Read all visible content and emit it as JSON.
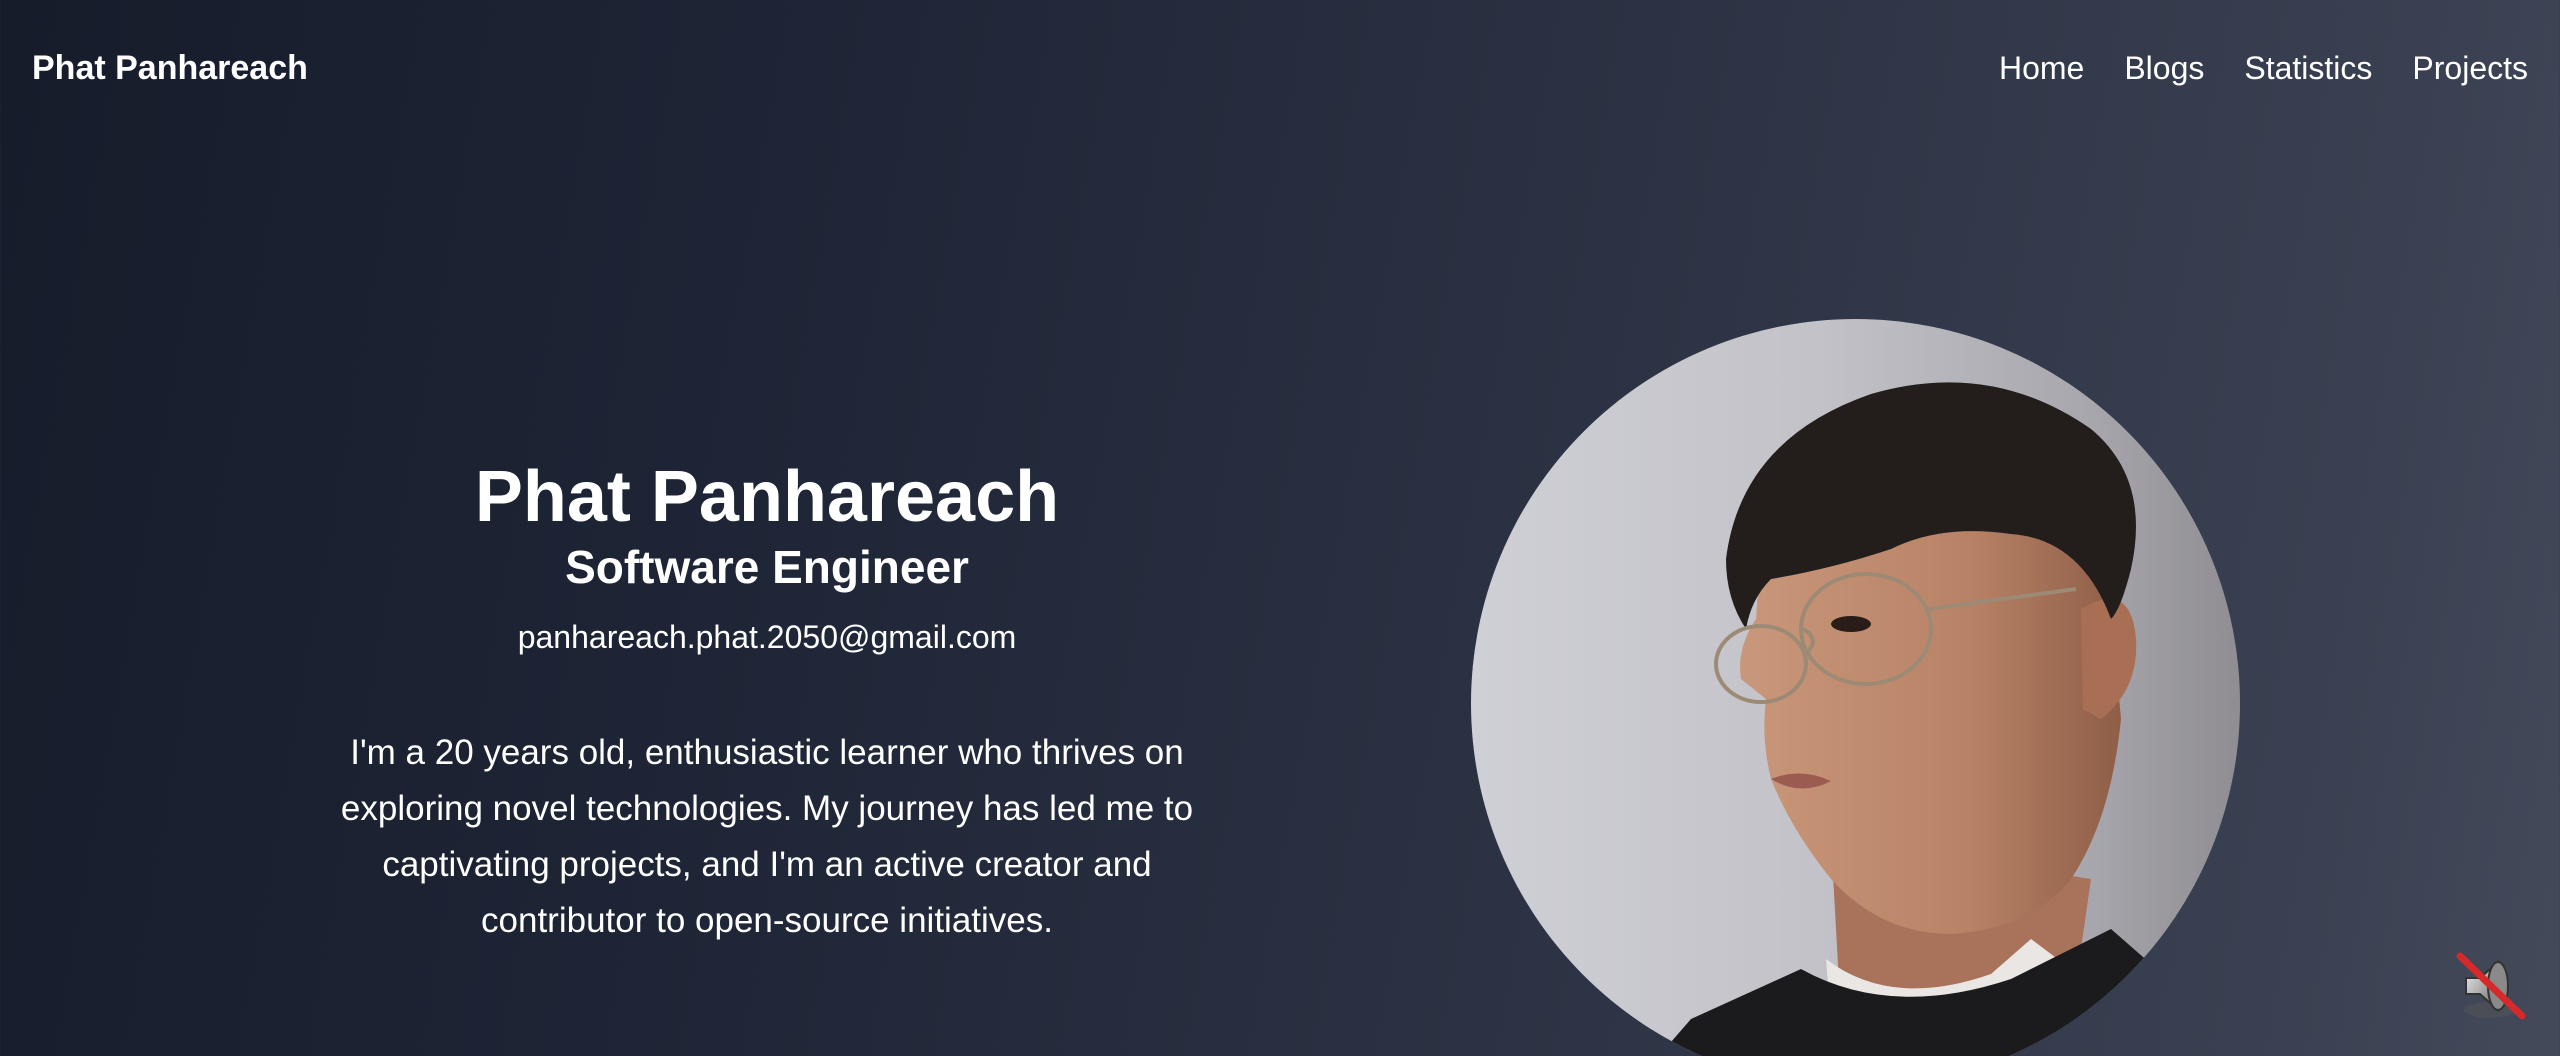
{
  "header": {
    "brand": "Phat Panhareach",
    "nav": [
      {
        "label": "Home"
      },
      {
        "label": "Blogs"
      },
      {
        "label": "Statistics"
      },
      {
        "label": "Projects"
      }
    ]
  },
  "hero": {
    "name": "Phat Panhareach",
    "title": "Software Engineer",
    "email": "panhareach.phat.2050@gmail.com",
    "bio": "I'm a 20 years old, enthusiastic learner who thrives on exploring novel technologies. My journey has led me to captivating projects, and I'm an active creator and contributor to open-source initiatives."
  },
  "icons": {
    "sound_toggle": "speaker-muted-icon"
  }
}
